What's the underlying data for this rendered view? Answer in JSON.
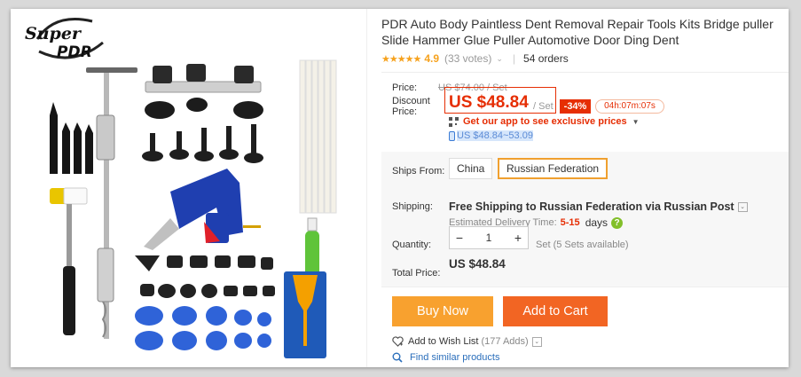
{
  "brand_logo": "Super PDR",
  "product": {
    "title": "PDR Auto Body Paintless Dent Removal Repair Tools Kits Bridge puller Slide Hammer Glue Puller Automotive Door Ding Dent",
    "rating": "4.9",
    "stars": "★★★★★",
    "votes": "(33 votes)",
    "orders": "54 orders"
  },
  "price": {
    "price_label": "Price:",
    "original": "US $74.00 / Set",
    "discount_label_1": "Discount",
    "discount_label_2": "Price:",
    "current": "US $48.84",
    "unit": "/ Set",
    "discount_pct": "-34%",
    "timer": "04h:07m:07s",
    "app_promo": "Get our app to see exclusive prices",
    "app_price_range": "US $48.84~53.09"
  },
  "shipping": {
    "ships_from_label": "Ships From:",
    "options": [
      "China",
      "Russian Federation"
    ],
    "selected": "Russian Federation",
    "shipping_label": "Shipping:",
    "shipping_text": "Free Shipping to Russian Federation via Russian Post",
    "delivery_label": "Estimated Delivery Time:",
    "delivery_days": "5-15",
    "delivery_unit": "days"
  },
  "quantity": {
    "label": "Quantity:",
    "value": "1",
    "minus": "−",
    "plus": "+",
    "available": "Set (5 Sets available)"
  },
  "total": {
    "label": "Total Price:",
    "value": "US $48.84"
  },
  "actions": {
    "buy_now": "Buy Now",
    "add_to_cart": "Add to Cart",
    "wish_list": "Add to Wish List",
    "wish_count": "(177 Adds)",
    "similar": "Find similar products"
  },
  "colors": {
    "price_red": "#e62e04",
    "buy_orange": "#f8a12f",
    "cart_orange": "#f26523",
    "star_gold": "#f6a21e",
    "link_blue": "#2a6ebb"
  }
}
